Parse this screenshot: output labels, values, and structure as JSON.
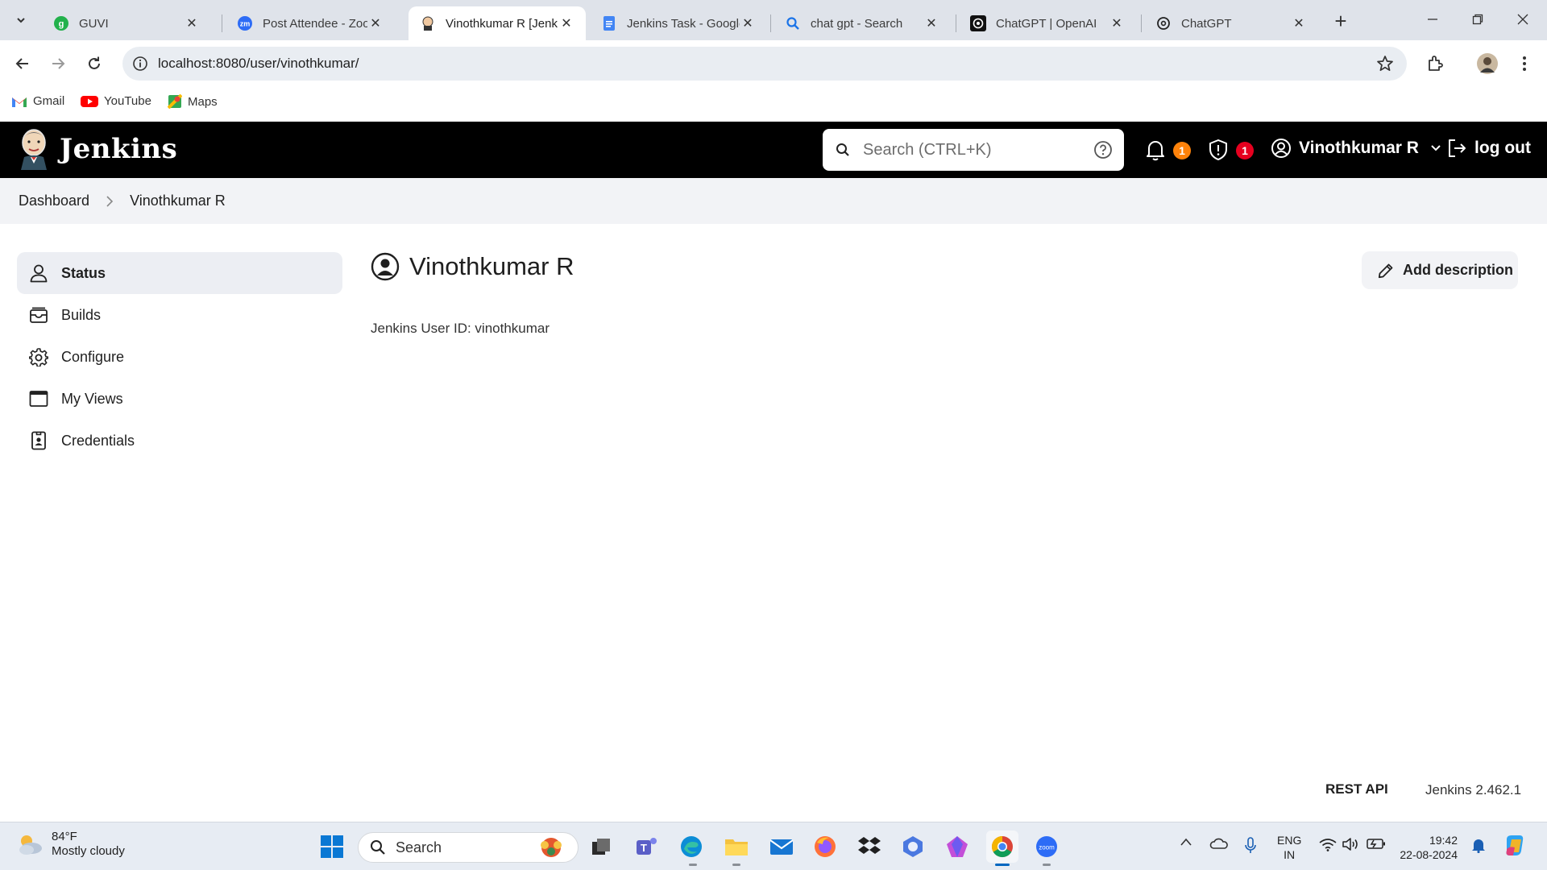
{
  "browser": {
    "tabs": [
      {
        "title": "GUVI",
        "icon": "guvi-icon",
        "active": false
      },
      {
        "title": "Post Attendee - Zoom",
        "icon": "zoom-icon",
        "active": false
      },
      {
        "title": "Vinothkumar R [Jenkins]",
        "icon": "jenkins-icon",
        "active": true
      },
      {
        "title": "Jenkins Task - Google Docs",
        "icon": "docs-icon",
        "active": false
      },
      {
        "title": "chat gpt - Search",
        "icon": "search-icon",
        "active": false
      },
      {
        "title": "ChatGPT | OpenAI",
        "icon": "openai-icon",
        "active": false
      },
      {
        "title": "ChatGPT",
        "icon": "openai-icon",
        "active": false
      }
    ],
    "url": "localhost:8080/user/vinothkumar/",
    "bookmarks": [
      {
        "label": "Gmail",
        "icon": "gmail-icon"
      },
      {
        "label": "YouTube",
        "icon": "youtube-icon"
      },
      {
        "label": "Maps",
        "icon": "maps-icon"
      }
    ]
  },
  "jenkins": {
    "brand": "Jenkins",
    "search_placeholder": "Search (CTRL+K)",
    "notifications_count": "1",
    "security_count": "1",
    "user_name": "Vinothkumar R",
    "logout_label": "log out",
    "colors": {
      "header": "#000000",
      "notification_badge": "#fe820a",
      "security_badge": "#e6001f"
    }
  },
  "breadcrumb": {
    "items": [
      "Dashboard",
      "Vinothkumar R"
    ]
  },
  "sidebar": {
    "items": [
      {
        "label": "Status",
        "icon": "user-icon",
        "active": true
      },
      {
        "label": "Builds",
        "icon": "builds-icon",
        "active": false
      },
      {
        "label": "Configure",
        "icon": "gear-icon",
        "active": false
      },
      {
        "label": "My Views",
        "icon": "window-icon",
        "active": false
      },
      {
        "label": "Credentials",
        "icon": "credentials-icon",
        "active": false
      }
    ]
  },
  "main": {
    "title": "Vinothkumar R",
    "add_description_label": "Add description",
    "user_id_text": "Jenkins User ID: vinothkumar"
  },
  "footer": {
    "rest_api": "REST API",
    "version": "Jenkins 2.462.1"
  },
  "taskbar": {
    "weather_temp": "84°F",
    "weather_desc": "Mostly cloudy",
    "search_label": "Search",
    "lang_line1": "ENG",
    "lang_line2": "IN",
    "time": "19:42",
    "date": "22-08-2024"
  }
}
